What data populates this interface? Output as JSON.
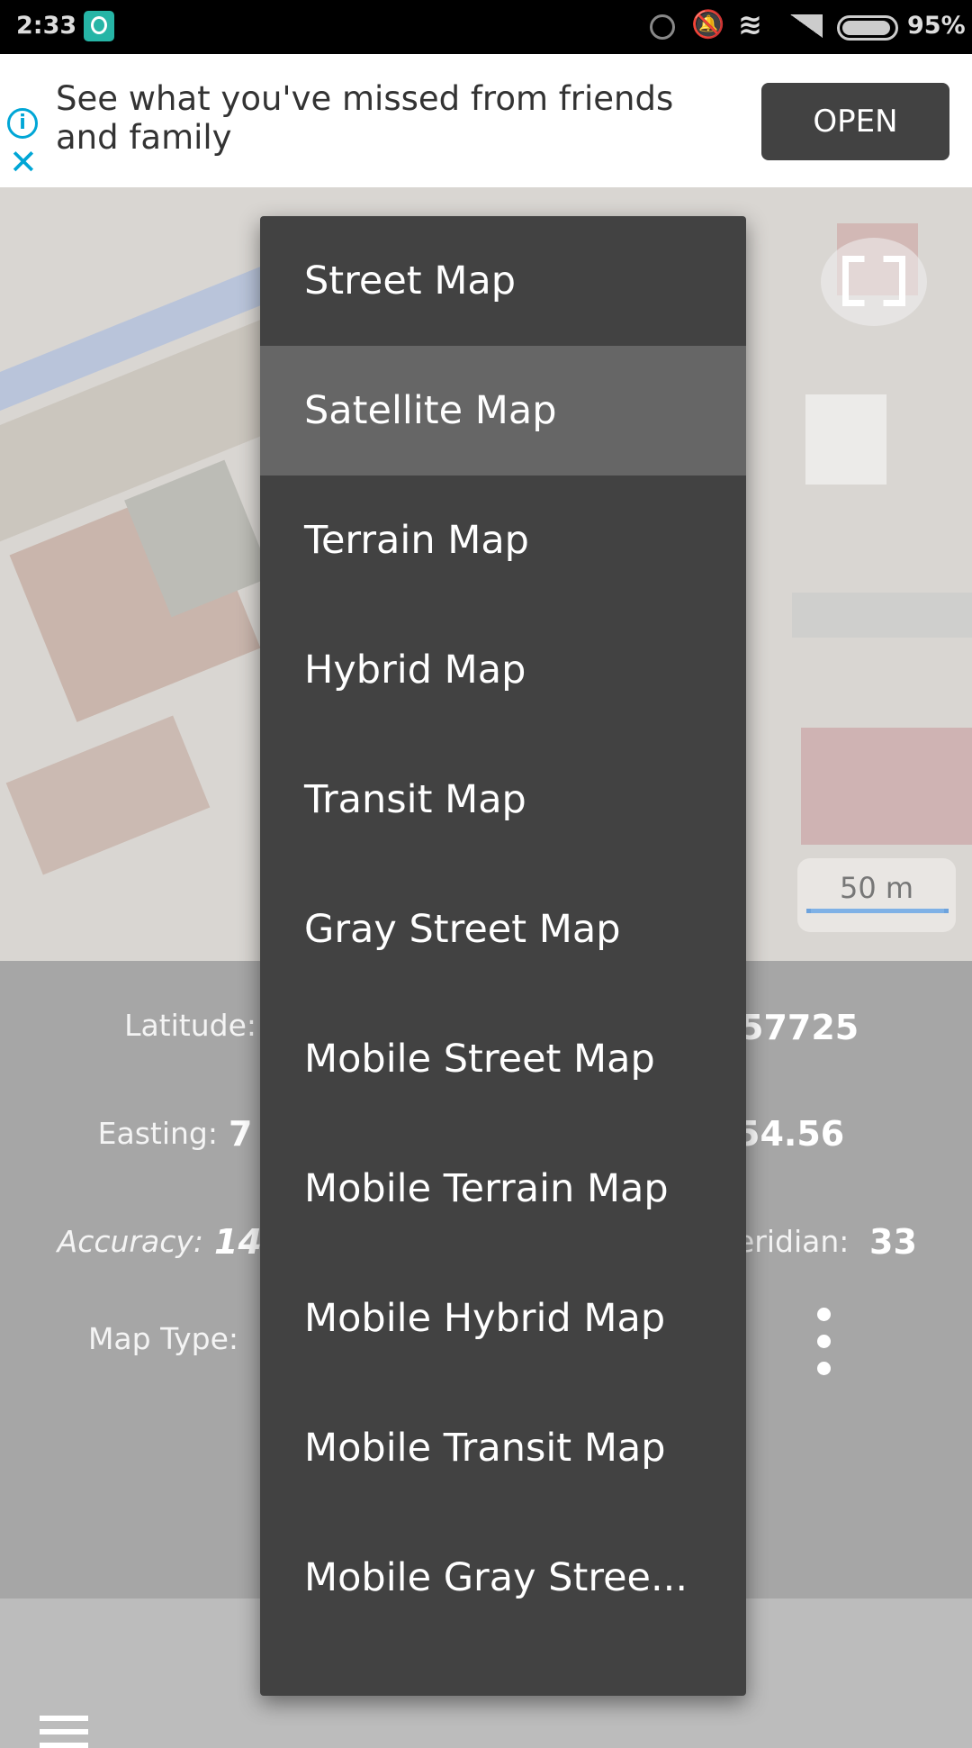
{
  "status_bar": {
    "time": "2:33",
    "battery": "95%",
    "icons": [
      "app-notification-icon",
      "hotspot-icon",
      "mute-icon",
      "wifi-icon",
      "signal-icon",
      "battery-icon"
    ]
  },
  "ad": {
    "text": "See what you've missed from friends and family",
    "button": "OPEN",
    "icons": [
      "info-icon",
      "close-icon"
    ]
  },
  "map": {
    "scale_label": "50 m",
    "fullscreen_icon": "fullscreen-icon"
  },
  "info": {
    "latitude_label": "Latitude:",
    "latitude_value_partial": "57725",
    "easting_label": "Easting:",
    "easting_value_partial": "7",
    "northing_value_partial": "54.56",
    "accuracy_label": "Accuracy:",
    "accuracy_value_partial": "14.",
    "meridian_label_partial": "eridian:",
    "meridian_value": "33",
    "map_type_label": "Map Type:"
  },
  "menu": {
    "selected": "Satellite Map",
    "items": [
      "Street Map",
      "Satellite Map",
      "Terrain Map",
      "Hybrid Map",
      "Transit Map",
      "Gray Street Map",
      "Mobile Street Map",
      "Mobile Terrain Map",
      "Mobile Hybrid Map",
      "Mobile Transit Map",
      "Mobile Gray Stree..."
    ]
  },
  "colors": {
    "menu_bg": "#424242",
    "menu_selected": "#666666",
    "panel": "#a6a6a6",
    "ad_button": "#424242",
    "ad_icon": "#00a6d6"
  }
}
